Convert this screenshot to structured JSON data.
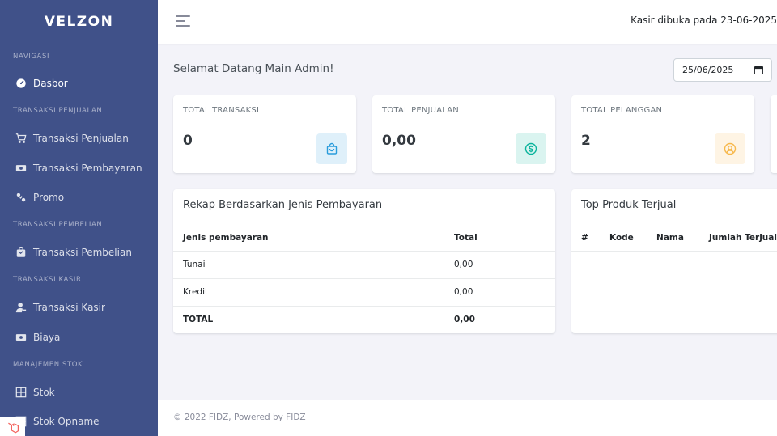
{
  "sidebar": {
    "logo": "VELZON",
    "sections": [
      {
        "title": "NAVIGASI",
        "items": [
          {
            "label": "Dasbor",
            "icon": "dashboard-icon",
            "active": true
          }
        ]
      },
      {
        "title": "TRANSAKSI PENJUALAN",
        "items": [
          {
            "label": "Transaksi Penjualan",
            "icon": "cart-icon"
          },
          {
            "label": "Transaksi Pembayaran",
            "icon": "money-icon"
          },
          {
            "label": "Promo",
            "icon": "promo-icon"
          }
        ]
      },
      {
        "title": "TRANSAKSI PEMBELIAN",
        "items": [
          {
            "label": "Transaksi Pembelian",
            "icon": "shopping-bag-icon"
          }
        ]
      },
      {
        "title": "TRANSAKSI KASIR",
        "items": [
          {
            "label": "Transaksi Kasir",
            "icon": "user-icon"
          },
          {
            "label": "Biaya",
            "icon": "money-icon"
          }
        ]
      },
      {
        "title": "MANAJEMEN STOK",
        "items": [
          {
            "label": "Stok",
            "icon": "grid-icon"
          },
          {
            "label": "Stok Opname",
            "icon": "grid-icon"
          }
        ]
      }
    ]
  },
  "header": {
    "kasir_info": "Kasir dibuka pada 23-06-2025"
  },
  "main": {
    "welcome": "Selamat Datang Main Admin!",
    "date_value": "25/06/2025",
    "stats": [
      {
        "label": "TOTAL TRANSAKSI",
        "value": "0",
        "icon": "shopping-bag-icon",
        "color": "#299cdb",
        "bg": "#dff0fa"
      },
      {
        "label": "TOTAL PENJUALAN",
        "value": "0,00",
        "icon": "dollar-circle-icon",
        "color": "#0ab39c",
        "bg": "#daf4f0"
      },
      {
        "label": "TOTAL PELANGGAN",
        "value": "2",
        "icon": "user-circle-icon",
        "color": "#f7b84b",
        "bg": "#fef4e4"
      }
    ],
    "rekap": {
      "title": "Rekap Berdasarkan Jenis Pembayaran",
      "headers": [
        "Jenis pembayaran",
        "Total"
      ],
      "rows": [
        [
          "Tunai",
          "0,00"
        ],
        [
          "Kredit",
          "0,00"
        ]
      ],
      "total_label": "TOTAL",
      "total_value": "0,00"
    },
    "top_produk": {
      "title": "Top Produk Terjual",
      "headers": [
        "#",
        "Kode",
        "Nama",
        "Jumlah Terjual"
      ]
    }
  },
  "footer": {
    "text": "© 2022 FIDZ, Powered by FIDZ"
  },
  "colors": {
    "sidebar": "#405189",
    "background": "#f3f3f9"
  }
}
